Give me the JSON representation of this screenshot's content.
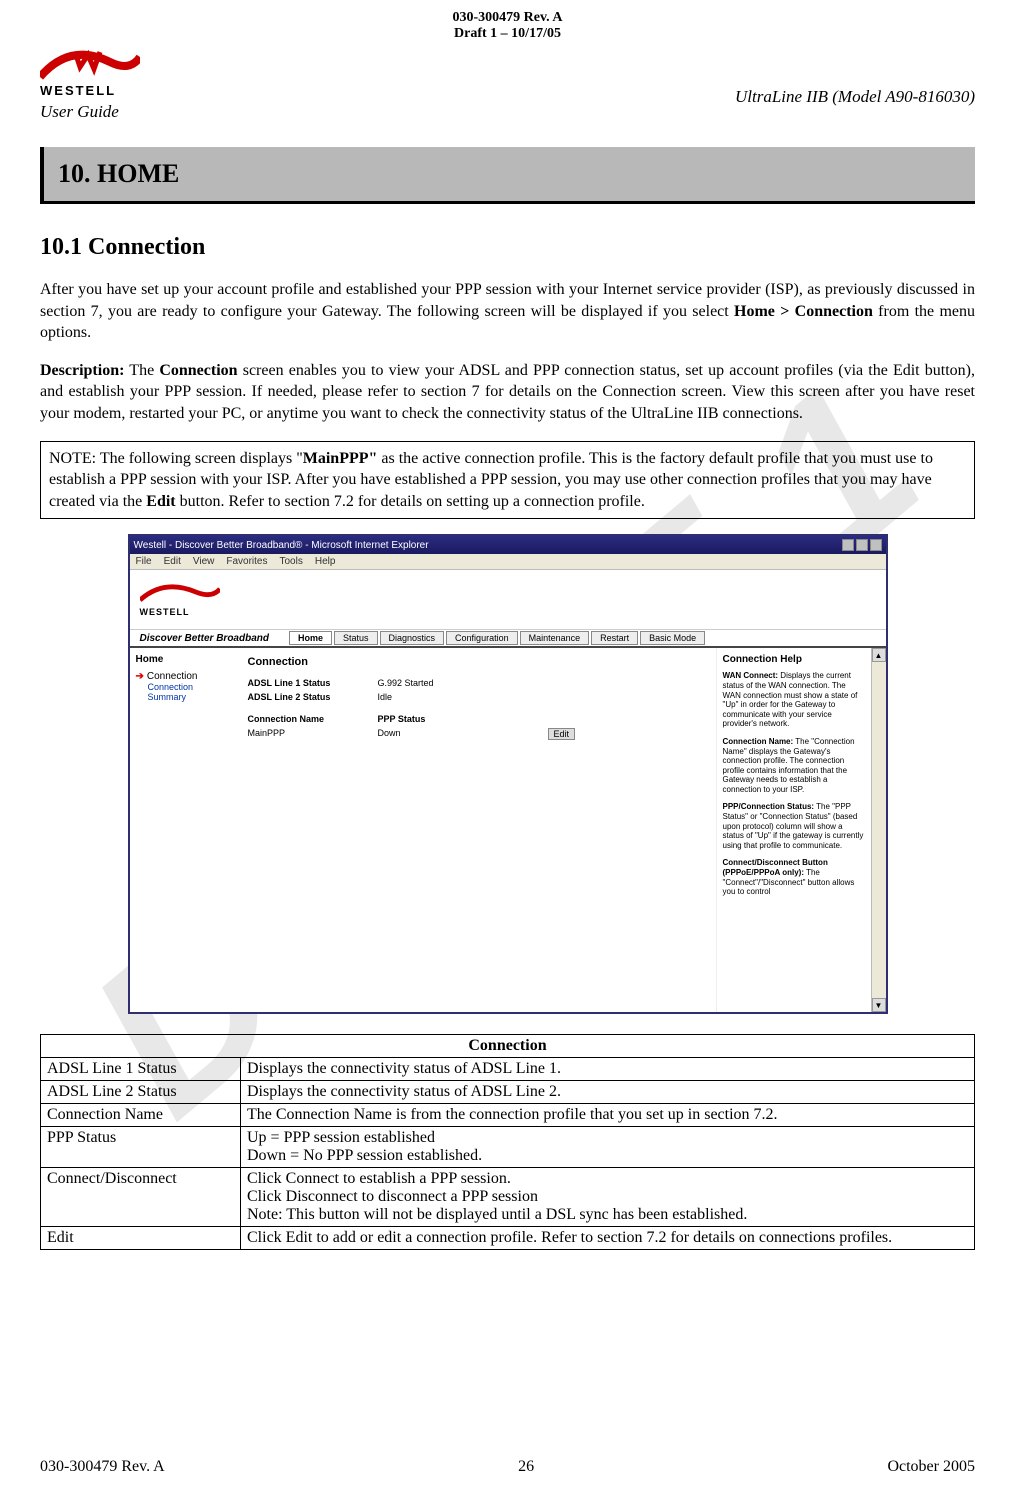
{
  "doc_header": {
    "line1": "030-300479 Rev. A",
    "line2": "Draft 1 – 10/17/05"
  },
  "brand_text": "WESTELL",
  "user_guide_label": "User Guide",
  "model_label": "UltraLine IIB (Model A90-816030)",
  "section_title": "10. HOME",
  "subsection_title": "10.1 Connection",
  "paragraph1_pre": "After you have set up your account profile and established your PPP session with your Internet service provider (ISP), as previously discussed in section 7, you are ready to configure your Gateway. The following screen will be displayed if you select ",
  "paragraph1_bold": "Home > Connection",
  "paragraph1_post": " from the menu options.",
  "paragraph2_b1": "Description:",
  "paragraph2_mid1": " The ",
  "paragraph2_b2": "Connection",
  "paragraph2_post": " screen enables you to view your ADSL and PPP connection status, set up account profiles (via the Edit button), and establish your PPP session. If needed, please refer to section 7 for details on the Connection screen. View this screen after you have reset your modem, restarted your PC, or anytime you want to check the connectivity status of the UltraLine IIB connections.",
  "note_pre": "NOTE: The following screen displays \"",
  "note_b1": "MainPPP\"",
  "note_mid": " as the active connection profile. This is the factory default profile that you must use to establish a PPP session with your ISP. After you have established a PPP session, you may use other connection profiles that you may have created via the ",
  "note_b2": "Edit",
  "note_post": " button. Refer to section 7.2 for details on setting up a connection profile.",
  "screenshot": {
    "window_title": "Westell - Discover Better Broadband® - Microsoft Internet Explorer",
    "menus": [
      "File",
      "Edit",
      "View",
      "Favorites",
      "Tools",
      "Help"
    ],
    "slogan": "Discover Better Broadband",
    "nav_tabs": [
      "Home",
      "Status",
      "Diagnostics",
      "Configuration",
      "Maintenance",
      "Restart",
      "Basic Mode"
    ],
    "sidebar_title": "Home",
    "sidebar_item": "Connection",
    "sidebar_sub": "Connection Summary",
    "main_title": "Connection",
    "adsl1_label": "ADSL Line 1 Status",
    "adsl1_value": "G.992 Started",
    "adsl2_label": "ADSL Line 2 Status",
    "adsl2_value": "Idle",
    "conn_name_label": "Connection Name",
    "ppp_status_label": "PPP Status",
    "conn_name_value": "MainPPP",
    "ppp_status_value": "Down",
    "edit_btn": "Edit",
    "help_title": "Connection Help",
    "help_wan_b": "WAN Connect:",
    "help_wan_t": " Displays the current status of the WAN connection. The WAN connection must show a state of \"Up\" in order for the Gateway to communicate with your service provider's network.",
    "help_cn_b": "Connection Name:",
    "help_cn_t": " The \"Connection Name\" displays the Gateway's connection profile. The connection profile contains information that the Gateway needs to establish a connection to your ISP.",
    "help_ppp_b": "PPP/Connection Status:",
    "help_ppp_t": " The \"PPP Status\" or \"Connection Status\" (based upon protocol) column will show a status of \"Up\" if the gateway is currently using that profile to communicate.",
    "help_btn_b": "Connect/Disconnect Button (PPPoE/PPPoA only):",
    "help_btn_t": " The \"Connect\"/\"Disconnect\" button allows you to control"
  },
  "table": {
    "header": "Connection",
    "rows": [
      {
        "label": "ADSL Line 1 Status",
        "desc": "Displays the connectivity status of ADSL Line 1."
      },
      {
        "label": "ADSL Line 2 Status",
        "desc": "Displays the connectivity status of ADSL Line 2."
      },
      {
        "label": "Connection Name",
        "desc": "The Connection Name is from the connection profile that you set up in section 7.2."
      },
      {
        "label": "PPP Status",
        "desc": "Up = PPP session established\nDown = No PPP session established."
      },
      {
        "label": "Connect/Disconnect",
        "desc": "Click Connect to establish a PPP session.\nClick Disconnect to disconnect a PPP session\nNote: This button will not be displayed until a DSL sync has been established."
      },
      {
        "label": "Edit",
        "desc": "Click Edit to add or edit a connection profile. Refer to section 7.2 for details on connections profiles."
      }
    ]
  },
  "footer": {
    "left": "030-300479 Rev. A",
    "center": "26",
    "right": "October 2005"
  },
  "watermark": "DRAFT 1"
}
